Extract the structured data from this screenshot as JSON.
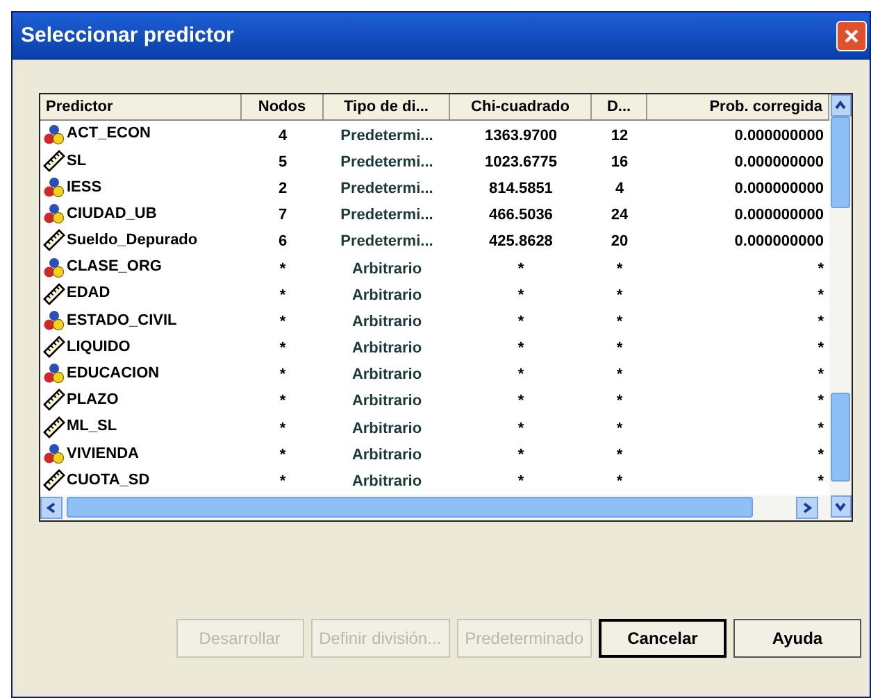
{
  "window": {
    "title": "Seleccionar predictor"
  },
  "table": {
    "columns": [
      "Predictor",
      "Nodos",
      "Tipo de di...",
      "Chi-cuadrado",
      "D...",
      "Prob. corregida"
    ],
    "rows": [
      {
        "kind": "nominal",
        "cells": [
          "ACT_ECON",
          "4",
          "Predetermi...",
          "1363.9700",
          "12",
          "0.000000000"
        ]
      },
      {
        "kind": "scale",
        "cells": [
          "SL",
          "5",
          "Predetermi...",
          "1023.6775",
          "16",
          "0.000000000"
        ]
      },
      {
        "kind": "nominal",
        "cells": [
          "IESS",
          "2",
          "Predetermi...",
          "814.5851",
          "4",
          "0.000000000"
        ]
      },
      {
        "kind": "nominal",
        "cells": [
          "CIUDAD_UB",
          "7",
          "Predetermi...",
          "466.5036",
          "24",
          "0.000000000"
        ]
      },
      {
        "kind": "scale",
        "cells": [
          "Sueldo_Depurado",
          "6",
          "Predetermi...",
          "425.8628",
          "20",
          "0.000000000"
        ]
      },
      {
        "kind": "nominal",
        "cells": [
          "CLASE_ORG",
          "*",
          "Arbitrario",
          "*",
          "*",
          "*"
        ]
      },
      {
        "kind": "scale",
        "cells": [
          "EDAD",
          "*",
          "Arbitrario",
          "*",
          "*",
          "*"
        ]
      },
      {
        "kind": "nominal",
        "cells": [
          "ESTADO_CIVIL",
          "*",
          "Arbitrario",
          "*",
          "*",
          "*"
        ]
      },
      {
        "kind": "scale",
        "cells": [
          "LIQUIDO",
          "*",
          "Arbitrario",
          "*",
          "*",
          "*"
        ]
      },
      {
        "kind": "nominal",
        "cells": [
          "EDUCACION",
          "*",
          "Arbitrario",
          "*",
          "*",
          "*"
        ]
      },
      {
        "kind": "scale",
        "cells": [
          "PLAZO",
          "*",
          "Arbitrario",
          "*",
          "*",
          "*"
        ]
      },
      {
        "kind": "scale",
        "cells": [
          "ML_SL",
          "*",
          "Arbitrario",
          "*",
          "*",
          "*"
        ]
      },
      {
        "kind": "nominal",
        "cells": [
          "VIVIENDA",
          "*",
          "Arbitrario",
          "*",
          "*",
          "*"
        ]
      },
      {
        "kind": "scale",
        "cells": [
          "CUOTA_SD",
          "*",
          "Arbitrario",
          "*",
          "*",
          "*"
        ]
      }
    ]
  },
  "buttons": [
    {
      "label": "Desarrollar",
      "disabled": true,
      "default": false
    },
    {
      "label": "Definir división...",
      "disabled": true,
      "default": false
    },
    {
      "label": "Predeterminado",
      "disabled": true,
      "default": false
    },
    {
      "label": "Cancelar",
      "disabled": false,
      "default": true
    },
    {
      "label": "Ayuda",
      "disabled": false,
      "default": false
    }
  ]
}
